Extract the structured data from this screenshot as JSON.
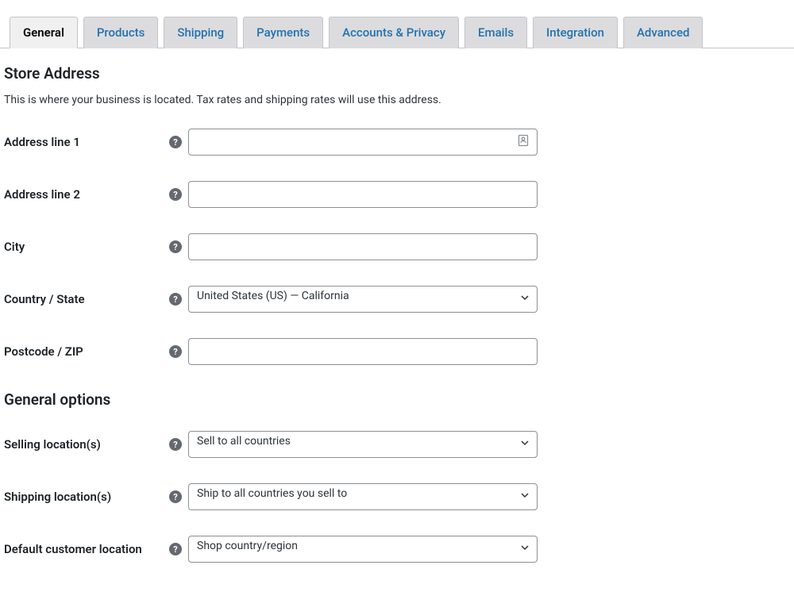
{
  "tabs": [
    {
      "label": "General",
      "active": true
    },
    {
      "label": "Products",
      "active": false
    },
    {
      "label": "Shipping",
      "active": false
    },
    {
      "label": "Payments",
      "active": false
    },
    {
      "label": "Accounts & Privacy",
      "active": false
    },
    {
      "label": "Emails",
      "active": false
    },
    {
      "label": "Integration",
      "active": false
    },
    {
      "label": "Advanced",
      "active": false
    }
  ],
  "section1": {
    "title": "Store Address",
    "description": "This is where your business is located. Tax rates and shipping rates will use this address."
  },
  "fields": {
    "address1": {
      "label": "Address line 1",
      "value": ""
    },
    "address2": {
      "label": "Address line 2",
      "value": ""
    },
    "city": {
      "label": "City",
      "value": ""
    },
    "country_state": {
      "label": "Country / State",
      "value": "United States (US) — California"
    },
    "postcode": {
      "label": "Postcode / ZIP",
      "value": ""
    }
  },
  "section2": {
    "title": "General options"
  },
  "options": {
    "selling_locations": {
      "label": "Selling location(s)",
      "value": "Sell to all countries"
    },
    "shipping_locations": {
      "label": "Shipping location(s)",
      "value": "Ship to all countries you sell to"
    },
    "default_customer_location": {
      "label": "Default customer location",
      "value": "Shop country/region"
    }
  }
}
